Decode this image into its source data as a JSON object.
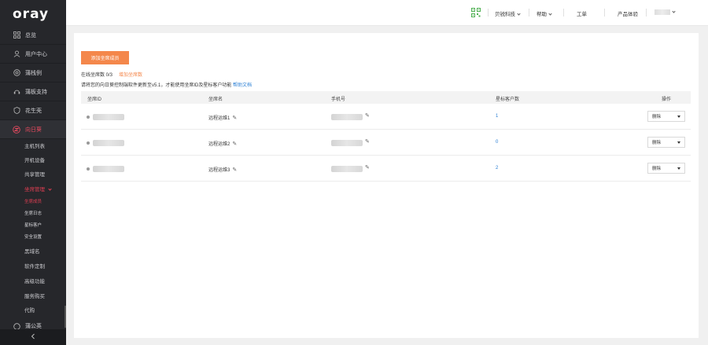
{
  "sidebar": {
    "logo": "oray",
    "items": [
      {
        "label": "总览",
        "icon": "grid-icon"
      },
      {
        "label": "用户中心",
        "icon": "user-icon"
      },
      {
        "label": "蒲栈例",
        "icon": "target-icon"
      },
      {
        "label": "蒲板支持",
        "icon": "support-icon"
      },
      {
        "label": "花生壳",
        "icon": "shield-icon"
      },
      {
        "label": "向日葵",
        "icon": "sunflower-icon"
      }
    ],
    "sub_items": [
      {
        "label": "主机列表"
      },
      {
        "label": "开机设备"
      },
      {
        "label": "共享管理"
      },
      {
        "label": "坐席管理"
      },
      {
        "label": "坐席成员"
      },
      {
        "label": "坐席日志"
      },
      {
        "label": "星标客户"
      },
      {
        "label": "安全设置"
      },
      {
        "label": "黑域名"
      },
      {
        "label": "软件定制"
      },
      {
        "label": "高级功能"
      },
      {
        "label": "服务购买"
      },
      {
        "label": "代购"
      }
    ],
    "partial_item": "蒲公英",
    "collapse_icon": "chevron-left-icon"
  },
  "topbar": {
    "qr_icon": "qr-code-icon",
    "company": "贝锐科技",
    "help": "帮助",
    "ticket": "工单",
    "feedback": "产品体验",
    "user": ""
  },
  "main": {
    "add_button": "添加坐席成员",
    "quota_label": "在线坐席数 0/3",
    "quota_add": "增加坐席数",
    "notice": "请将您的向日葵控制端软件更新至v5.1，才能使用坐席ID及星标客户功能",
    "notice_link": "帮助文档",
    "columns": [
      "坐席ID",
      "坐席名",
      "手机号",
      "星标客户数",
      "操作"
    ],
    "rows": [
      {
        "name": "远程运维1",
        "stars": "1",
        "action": "删除"
      },
      {
        "name": "远程运维2",
        "stars": "0",
        "action": "删除"
      },
      {
        "name": "远程运维3",
        "stars": "2",
        "action": "删除"
      }
    ]
  }
}
